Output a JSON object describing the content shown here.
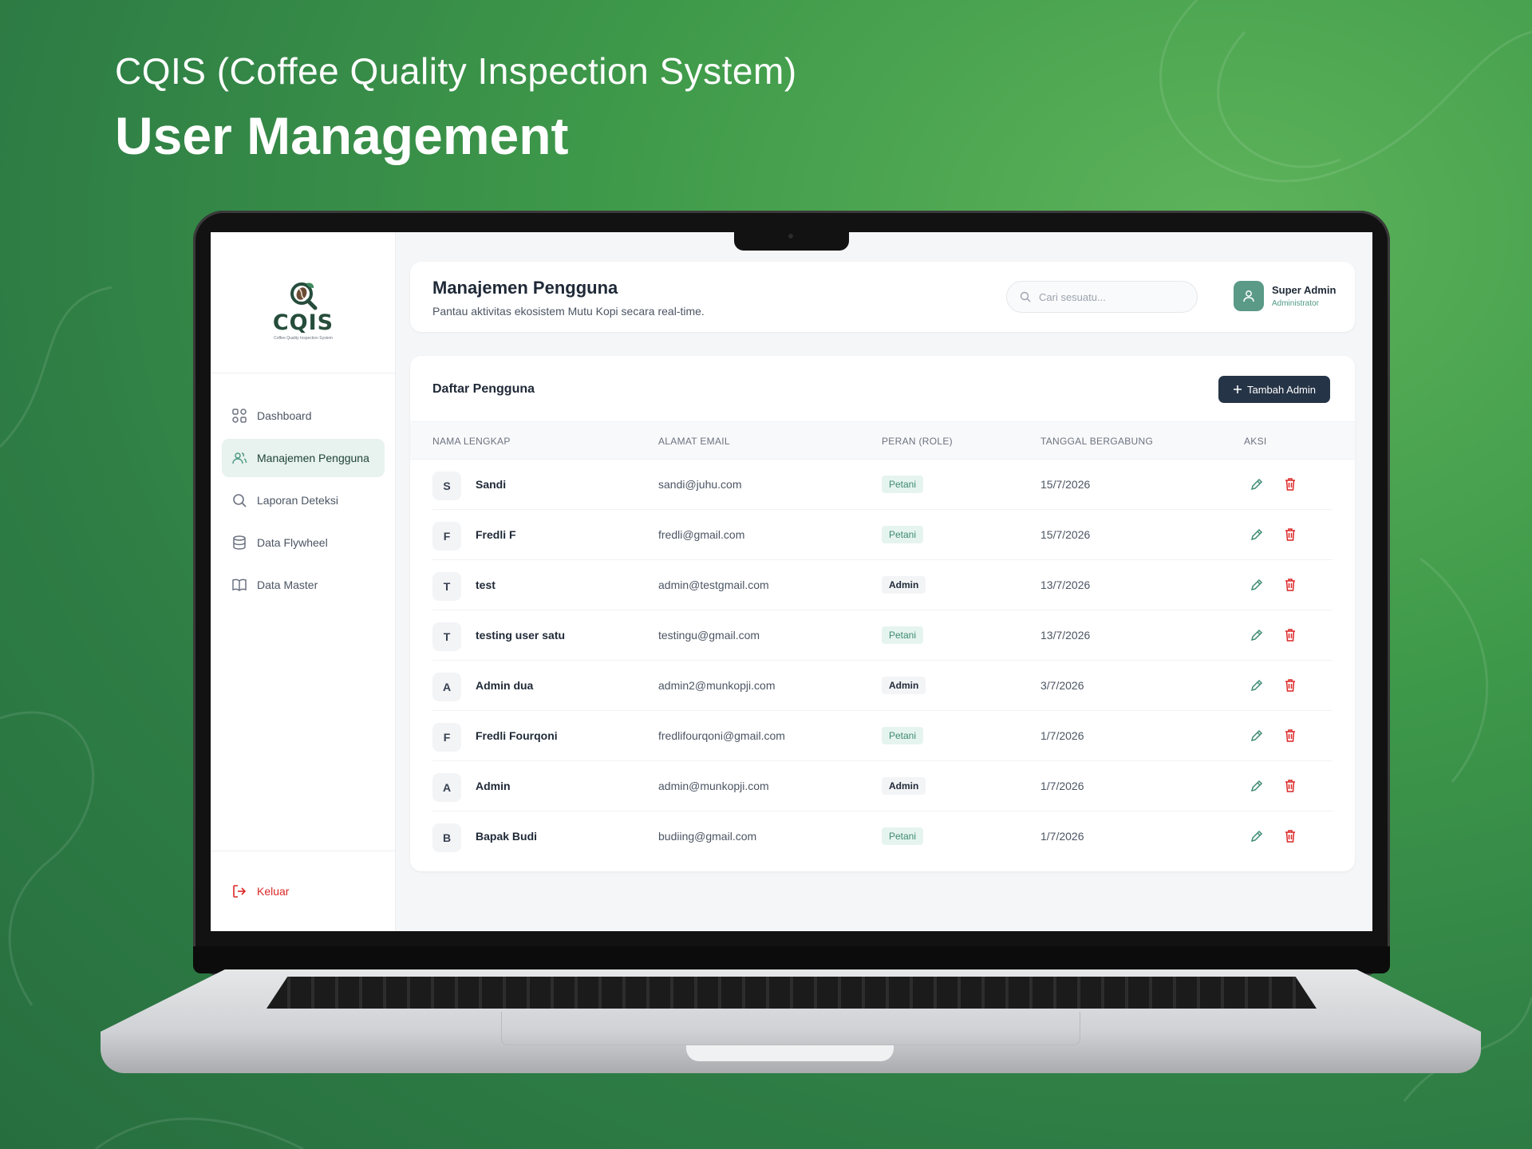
{
  "hero": {
    "subtitle": "CQIS (Coffee Quality Inspection System)",
    "title": "User Management"
  },
  "brand": {
    "name": "CQIS",
    "tagline": "Coffee Quality Inspection System"
  },
  "sidebar": {
    "items": [
      {
        "label": "Dashboard",
        "icon": "grid-icon"
      },
      {
        "label": "Manajemen Pengguna",
        "icon": "users-icon",
        "active": true
      },
      {
        "label": "Laporan Deteksi",
        "icon": "search-icon"
      },
      {
        "label": "Data Flywheel",
        "icon": "database-icon"
      },
      {
        "label": "Data Master",
        "icon": "book-icon"
      }
    ],
    "logout_label": "Keluar"
  },
  "header": {
    "title": "Manajemen Pengguna",
    "subtitle": "Pantau aktivitas ekosistem Mutu Kopi secara real-time.",
    "search_placeholder": "Cari sesuatu...",
    "user_name": "Super Admin",
    "user_role": "Administrator"
  },
  "table": {
    "title": "Daftar Pengguna",
    "add_label": "Tambah Admin",
    "columns": [
      "NAMA LENGKAP",
      "ALAMAT EMAIL",
      "PERAN (ROLE)",
      "TANGGAL BERGABUNG",
      "AKSI"
    ],
    "rows": [
      {
        "initial": "S",
        "name": "Sandi",
        "email": "sandi@juhu.com",
        "role": "Petani",
        "joined": "15/7/2026"
      },
      {
        "initial": "F",
        "name": "Fredli F",
        "email": "fredli@gmail.com",
        "role": "Petani",
        "joined": "15/7/2026"
      },
      {
        "initial": "T",
        "name": "test",
        "email": "admin@testgmail.com",
        "role": "Admin",
        "joined": "13/7/2026"
      },
      {
        "initial": "T",
        "name": "testing user satu",
        "email": "testingu@gmail.com",
        "role": "Petani",
        "joined": "13/7/2026"
      },
      {
        "initial": "A",
        "name": "Admin dua",
        "email": "admin2@munkopji.com",
        "role": "Admin",
        "joined": "3/7/2026"
      },
      {
        "initial": "F",
        "name": "Fredli Fourqoni",
        "email": "fredlifourqoni@gmail.com",
        "role": "Petani",
        "joined": "1/7/2026"
      },
      {
        "initial": "A",
        "name": "Admin",
        "email": "admin@munkopji.com",
        "role": "Admin",
        "joined": "1/7/2026"
      },
      {
        "initial": "B",
        "name": "Bapak Budi",
        "email": "budiing@gmail.com",
        "role": "Petani",
        "joined": "1/7/2026"
      }
    ]
  },
  "colors": {
    "background": "#3f9a4a",
    "primary_button": "#263447",
    "accent": "#5a9a87",
    "danger": "#dc2626",
    "edit": "#3d8a72"
  }
}
